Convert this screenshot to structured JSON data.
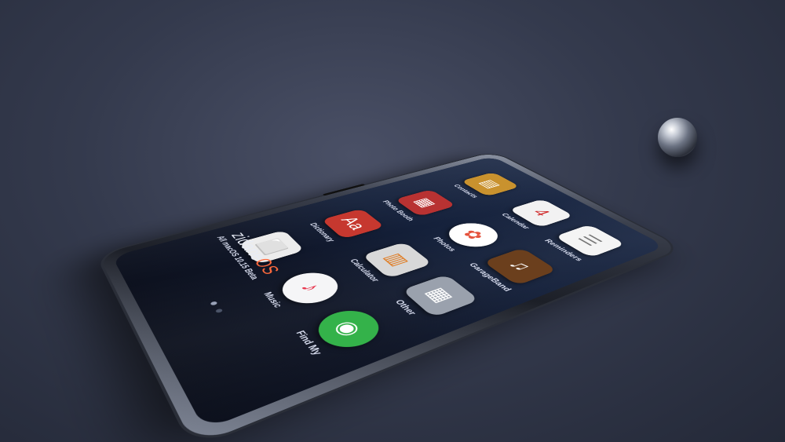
{
  "apps": [
    {
      "label": "Contacts",
      "icon": "contacts-icon",
      "glyph": "▤",
      "bg": "#c9922e"
    },
    {
      "label": "Calendar",
      "icon": "calendar-icon",
      "glyph": "4",
      "bg": "#f2f2f2",
      "fg": "#d02a2a"
    },
    {
      "label": "Reminders",
      "icon": "reminders-icon",
      "glyph": "☰",
      "bg": "#f4f4f4",
      "fg": "#777"
    },
    {
      "label": "Photo Booth",
      "icon": "photo-booth-icon",
      "glyph": "▦",
      "bg": "#b83232"
    },
    {
      "label": "Photos",
      "icon": "photos-icon",
      "glyph": "✿",
      "bg": "#ffffff",
      "fg": "#e5533d"
    },
    {
      "label": "GarageBand",
      "icon": "garageband-icon",
      "glyph": "♫",
      "bg": "#6b3f1d"
    },
    {
      "label": "Dictionary",
      "icon": "dictionary-icon",
      "glyph": "Aa",
      "bg": "#c6382f"
    },
    {
      "label": "Calculator",
      "icon": "calculator-icon",
      "glyph": "▥",
      "bg": "#d8d8d8",
      "fg": "#e07a1f"
    },
    {
      "label": "Other",
      "icon": "other-folder-icon",
      "glyph": "▦",
      "bg": "#9aa1ad"
    },
    {
      "label": "All macOS 10.15 Beta",
      "icon": "document-icon",
      "glyph": "⬜",
      "bg": "#ececec",
      "fg": "#999"
    },
    {
      "label": "Music",
      "icon": "music-icon",
      "glyph": "♪",
      "bg": "#f5f5f7",
      "fg": "#e8374f"
    },
    {
      "label": "Find My",
      "icon": "find-my-icon",
      "glyph": "◉",
      "bg": "#34b24a"
    }
  ],
  "brand": {
    "name": "zidane",
    "os": "OS"
  }
}
